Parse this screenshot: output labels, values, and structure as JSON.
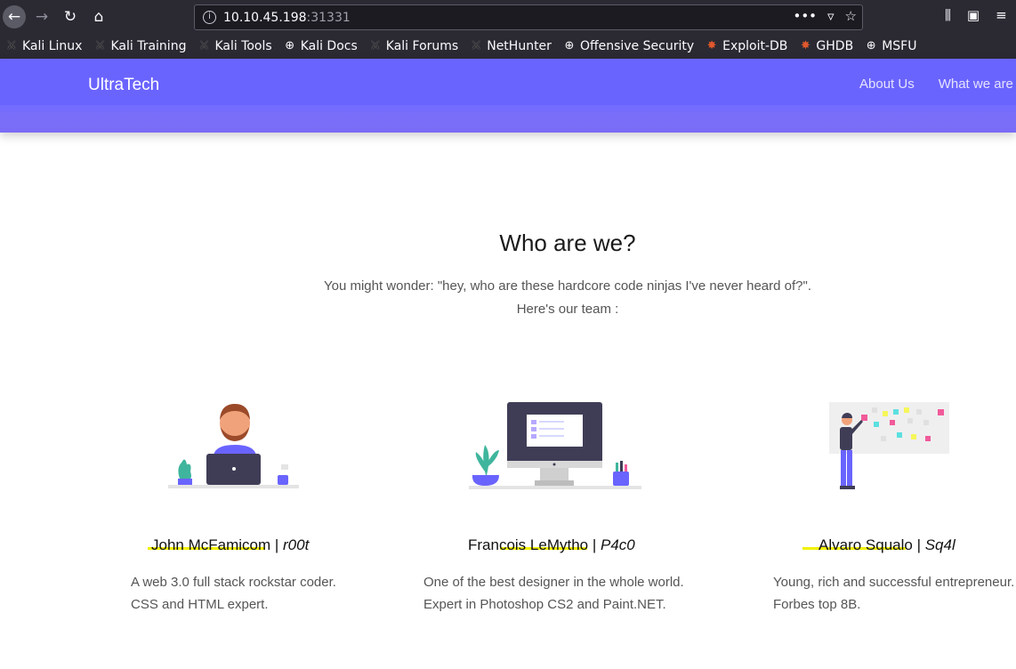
{
  "browser": {
    "url_host": "10.10.45.198",
    "url_port": ":31331",
    "bookmarks": [
      {
        "label": "Kali Linux",
        "icon": "kali-dragon-icon"
      },
      {
        "label": "Kali Training",
        "icon": "kali-dragon-icon"
      },
      {
        "label": "Kali Tools",
        "icon": "kali-dragon-icon"
      },
      {
        "label": "Kali Docs",
        "icon": "globe-icon"
      },
      {
        "label": "Kali Forums",
        "icon": "kali-dragon-icon"
      },
      {
        "label": "NetHunter",
        "icon": "kali-dragon-icon"
      },
      {
        "label": "Offensive Security",
        "icon": "globe-icon"
      },
      {
        "label": "Exploit-DB",
        "icon": "exploitdb-icon"
      },
      {
        "label": "GHDB",
        "icon": "exploitdb-icon"
      },
      {
        "label": "MSFU",
        "icon": "globe-icon"
      }
    ]
  },
  "site": {
    "brand": "UltraTech",
    "nav": [
      "About Us",
      "What we are"
    ],
    "accent": "#6a64ff"
  },
  "about": {
    "title": "Who are we?",
    "subtitle_line1": "You might wonder: \"hey, who are these hardcore code ninjas I've never heard of?\".",
    "subtitle_line2": "Here's our team :"
  },
  "team": [
    {
      "name": "John McFamicom",
      "sep": " | ",
      "handle": "r00t",
      "desc1": "A web 3.0 full stack rockstar coder.",
      "desc2": "CSS and HTML expert."
    },
    {
      "name": "Francois LeMytho",
      "sep": " | ",
      "handle": "P4c0",
      "desc1": "One of the best designer in the whole world.",
      "desc2": "Expert in Photoshop CS2 and Paint.NET."
    },
    {
      "name": "Alvaro Squalo",
      "sep": " | ",
      "handle": "Sq4l",
      "desc1": "Young, rich and successful entrepreneur.",
      "desc2": "Forbes top 8B."
    }
  ]
}
